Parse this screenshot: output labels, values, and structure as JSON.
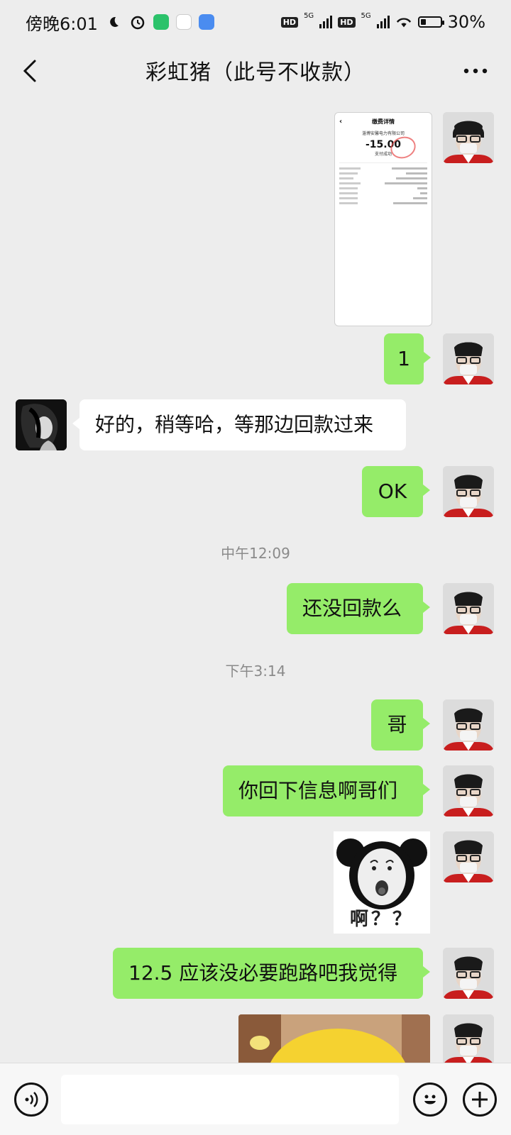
{
  "status_bar": {
    "time": "傍晚6:01",
    "hd1": "HD",
    "net1": "5G",
    "hd2": "HD",
    "net2": "5G",
    "battery": "30%",
    "battery_level": 0.3
  },
  "header": {
    "title": "彩虹猪（此号不收款）",
    "back_icon": "chevron-left-icon",
    "more_icon": "more-dots-icon"
  },
  "screenshot_msg": {
    "title": "缴费详情",
    "amount": "-15.00",
    "payee_line": "淄博安馨电力有限公司",
    "status": "支付成功"
  },
  "messages": {
    "m1": "1",
    "m2": "好的，稍等哈，等那边回款过来",
    "m3": "OK",
    "ts1": "中午12:09",
    "m4": "还没回款么",
    "ts2": "下午3:14",
    "m5": "哥",
    "m6": "你回下信息啊哥们",
    "sticker_text": "啊？？",
    "m7": "12.5 应该没必要跑路吧我觉得"
  },
  "input_bar": {
    "voice_icon": "voice-icon",
    "emoji_icon": "emoji-icon",
    "plus_icon": "plus-icon",
    "input_value": ""
  },
  "colors": {
    "bubble_me": "#95ec69",
    "bubble_peer": "#ffffff",
    "background": "#ededed"
  }
}
